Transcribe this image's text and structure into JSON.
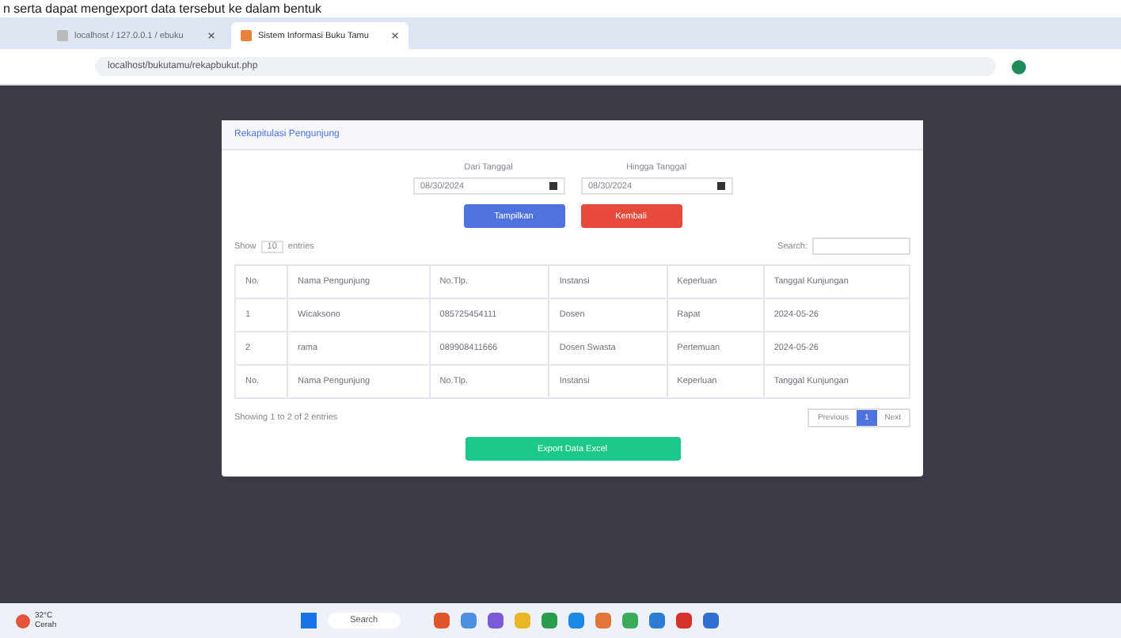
{
  "caption": "n serta dapat mengexport data tersebut ke dalam bentuk",
  "tabs": [
    {
      "label": "localhost / 127.0.0.1 / ebuku",
      "selected": false
    },
    {
      "label": "Sistem Informasi Buku Tamu",
      "selected": true
    }
  ],
  "address": "localhost/bukutamu/rekapbukut.php",
  "card_title": "Rekapitulasi Pengunjung",
  "filters": [
    {
      "label": "Dari Tanggal",
      "value": "08/30/2024"
    },
    {
      "label": "Hingga Tanggal",
      "value": "08/30/2024"
    }
  ],
  "buttons": [
    {
      "label": "Tampilkan",
      "kind": "primary"
    },
    {
      "label": "Kembali",
      "kind": "danger"
    }
  ],
  "length": {
    "before": "Show",
    "value": "10",
    "after": "entries"
  },
  "search_label": "Search:",
  "columns": [
    "No.",
    "Nama Pengunjung",
    "No.Tlp.",
    "Instansi",
    "Keperluan",
    "Tanggal Kunjungan"
  ],
  "footer_columns": [
    "No.",
    "Nama Pengunjung",
    "No.Tlp.",
    "Instansi",
    "Keperluan",
    "Tanggal Kunjungan"
  ],
  "rows": [
    [
      "1",
      "Wicaksono",
      "085725454111",
      "Dosen",
      "Rapat",
      "2024-05-26"
    ],
    [
      "2",
      "rama",
      "089908411666",
      "Dosen Swasta",
      "Pertemuan",
      "2024-05-26"
    ]
  ],
  "info": "Showing 1 to 2 of 2 entries",
  "pages": [
    {
      "label": "Previous",
      "selected": false
    },
    {
      "label": "1",
      "selected": true
    },
    {
      "label": "Next",
      "selected": false
    }
  ],
  "export_button": "Export Data Excel",
  "taskbar": {
    "weather_temp": "32°C",
    "weather_text": "Cerah",
    "search": "Search"
  }
}
